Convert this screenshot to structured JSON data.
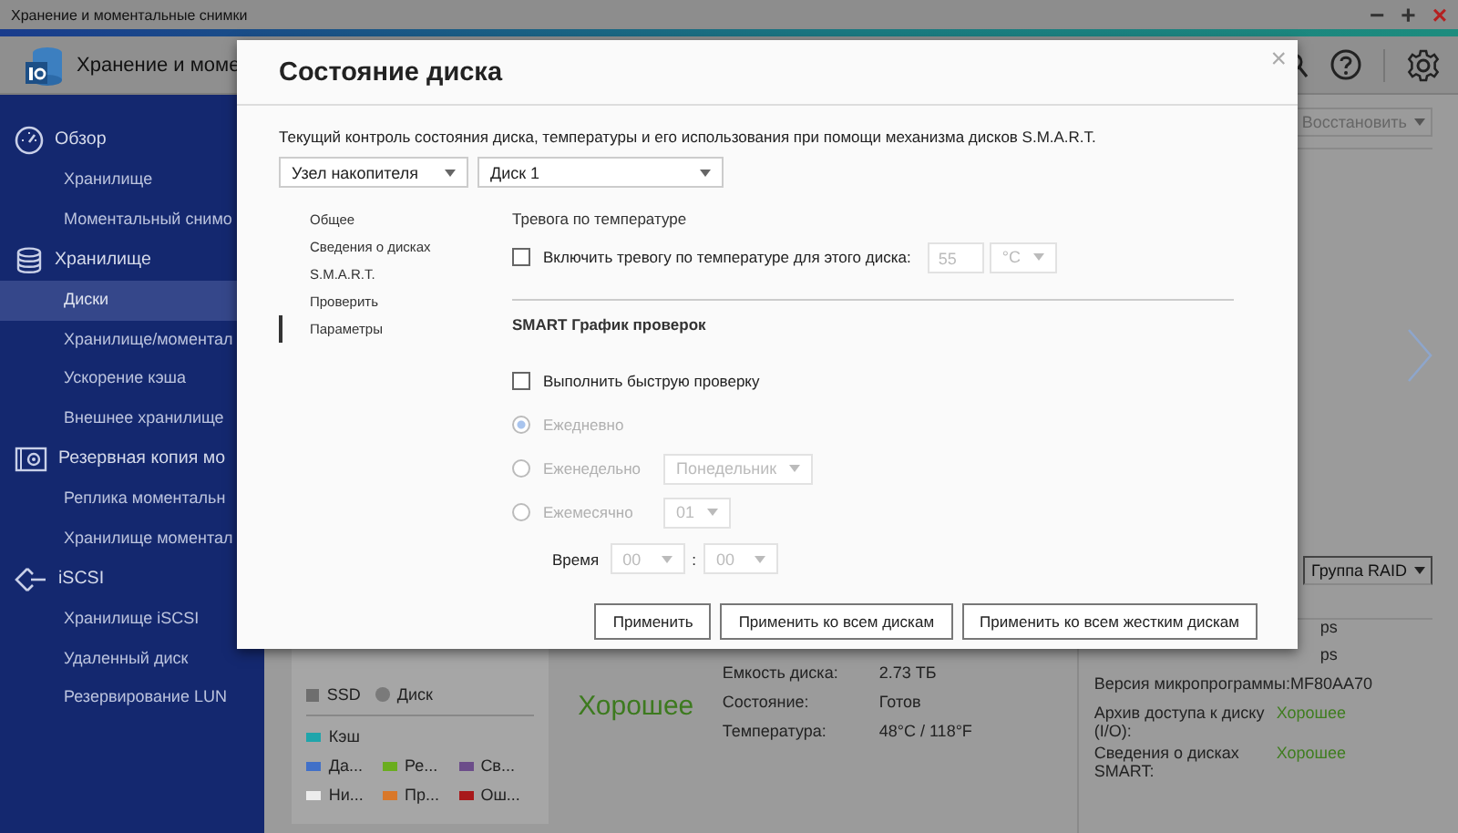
{
  "window": {
    "title": "Хранение и моментальные снимки",
    "controls": [
      {
        "kind": "minimize",
        "glyph": "−"
      },
      {
        "kind": "maximize",
        "glyph": "+"
      },
      {
        "kind": "close",
        "glyph": "×"
      }
    ]
  },
  "app_header": {
    "title": "Хранение и моме"
  },
  "sidebar": {
    "sections": [
      {
        "kind": "gauge",
        "title": "Обзор",
        "items": [
          {
            "label": "Хранилище",
            "selected": false
          },
          {
            "label": "Моментальный снимо",
            "selected": false
          }
        ]
      },
      {
        "kind": "database",
        "title": "Хранилище",
        "items": [
          {
            "label": "Диски",
            "selected": true
          },
          {
            "label": "Хранилище/моментал",
            "selected": false
          },
          {
            "label": "Ускорение кэша",
            "selected": false
          },
          {
            "label": "Внешнее хранилище",
            "selected": false
          }
        ]
      },
      {
        "kind": "backup",
        "title": "Резервная копия мо",
        "items": [
          {
            "label": "Реплика моментальн",
            "selected": false
          },
          {
            "label": "Хранилище моментал",
            "selected": false
          }
        ]
      },
      {
        "kind": "iscsi",
        "title": "iSCSI",
        "items": [
          {
            "label": "Хранилище iSCSI",
            "selected": false
          },
          {
            "label": "Удаленный диск",
            "selected": false
          },
          {
            "label": "Резервирование LUN",
            "selected": false
          }
        ]
      }
    ]
  },
  "toolbar": {
    "restore_button": "Восстановить"
  },
  "raid_button": "Группа RAID",
  "legend": {
    "types": [
      {
        "kind": "square",
        "label": "SSD"
      },
      {
        "kind": "circle",
        "label": "Диск"
      }
    ],
    "items": [
      {
        "label": "Кэш",
        "color": "#1fa5ab"
      },
      {
        "label": "Да...",
        "color": "#4170c8"
      },
      {
        "label": "Ре...",
        "color": "#6aad1e"
      },
      {
        "label": "Св...",
        "color": "#6c4d8a"
      },
      {
        "label": "Ни...",
        "color": "#ececec"
      },
      {
        "label": "Пр...",
        "color": "#d9782a"
      },
      {
        "label": "Ош...",
        "color": "#a8191b"
      }
    ]
  },
  "health": {
    "label": "Хорошее"
  },
  "info": [
    {
      "label": "Емкость диска:",
      "value": "2.73 ТБ"
    },
    {
      "label": "Состояние:",
      "value": "Готов"
    },
    {
      "label": "Температура:",
      "value": "48°C / 118°F"
    }
  ],
  "details": [
    {
      "value": "ps",
      "kind": "text"
    },
    {
      "value": "ps",
      "kind": "text"
    },
    {
      "label": "Версия микропрограммы:",
      "value": "MF80AA70",
      "kind": "text"
    },
    {
      "label": "Архив доступа к диску (I/O):",
      "value": "Хорошее",
      "kind": "status"
    },
    {
      "label": "Сведения о дисках SMART:",
      "value": "Хорошее",
      "kind": "status"
    }
  ],
  "dialog": {
    "title": "Состояние диска",
    "close": "×",
    "description": "Текущий контроль состояния диска, температуры и его использования при помощи механизма дисков S.M.A.R.T.",
    "selectors": [
      "Узел накопителя",
      "Диск 1"
    ],
    "nav": [
      {
        "label": "Общее",
        "selected": false
      },
      {
        "label": "Сведения о дисках",
        "selected": false
      },
      {
        "label": "S.M.A.R.T.",
        "selected": false
      },
      {
        "label": "Проверить",
        "selected": false
      },
      {
        "label": "Параметры",
        "selected": true
      }
    ],
    "temperature": {
      "heading": "Тревога по температуре",
      "checkbox": {
        "label": "Включить тревогу по температуре для этого диска:",
        "checked": false
      },
      "threshold": "55",
      "unit": "°C"
    },
    "schedule": {
      "heading": "SMART График проверок",
      "quick_test": {
        "label": "Выполнить быструю проверку",
        "checked": false
      },
      "frequencies": [
        {
          "label": "Ежедневно",
          "selected": true
        },
        {
          "label": "Еженедельно",
          "selected": false,
          "option": "Понедельник"
        },
        {
          "label": "Ежемесячно",
          "selected": false,
          "option": "01"
        }
      ],
      "time": {
        "label": "Время",
        "hour": "00",
        "separator": ":",
        "minute": "00"
      }
    },
    "buttons": [
      "Применить",
      "Применить ко всем дискам",
      "Применить ко всем жестким дискам"
    ]
  }
}
